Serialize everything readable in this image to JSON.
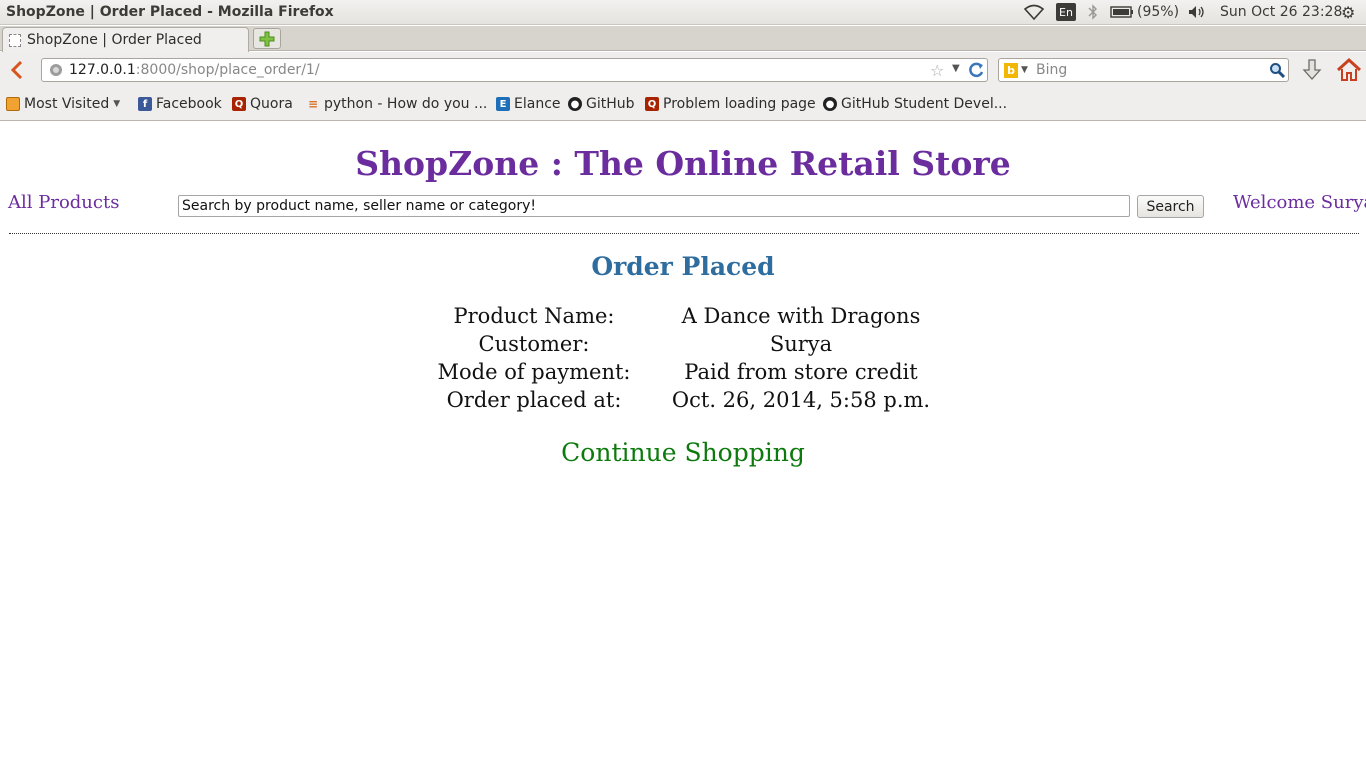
{
  "window": {
    "title": "ShopZone | Order Placed - Mozilla Firefox"
  },
  "system_tray": {
    "keyboard_lang": "En",
    "battery": "(95%)",
    "clock": "Sun Oct 26 23:28",
    "icons": [
      "wifi-icon",
      "bluetooth-icon",
      "battery-icon",
      "volume-icon",
      "gear-icon"
    ]
  },
  "browser": {
    "tab_label": "ShopZone | Order Placed",
    "url_host": "127.0.0.1",
    "url_rest": ":8000/shop/place_order/1/",
    "search_engine": "Bing",
    "search_placeholder": "Bing",
    "bookmarks": [
      {
        "label": "Most Visited",
        "icon": "most-visited-icon"
      },
      {
        "label": "Facebook",
        "icon": "facebook-icon"
      },
      {
        "label": "Quora",
        "icon": "quora-icon"
      },
      {
        "label": "python - How do you ...",
        "icon": "stackoverflow-icon"
      },
      {
        "label": "Elance",
        "icon": "elance-icon"
      },
      {
        "label": "GitHub",
        "icon": "github-icon"
      },
      {
        "label": "Problem loading page",
        "icon": "quora-icon"
      },
      {
        "label": "GitHub Student Devel...",
        "icon": "github-icon"
      }
    ]
  },
  "page": {
    "site_title": "ShopZone : The Online Retail Store",
    "nav": {
      "all_products": "All Products",
      "search_value": "Search by product name, seller name or category!",
      "search_button": "Search",
      "welcome": "Welcome Surya"
    },
    "order": {
      "heading": "Order Placed",
      "rows": [
        {
          "label": "Product Name:",
          "value": "A Dance with Dragons"
        },
        {
          "label": "Customer:",
          "value": "Surya"
        },
        {
          "label": "Mode of payment:",
          "value": "Paid from store credit"
        },
        {
          "label": "Order placed at:",
          "value": "Oct. 26, 2014, 5:58 p.m."
        }
      ],
      "continue_link": "Continue Shopping"
    }
  },
  "colors": {
    "title_purple": "#6b2d9e",
    "heading_blue": "#2f6d9e",
    "link_green": "#0c7a0c"
  }
}
